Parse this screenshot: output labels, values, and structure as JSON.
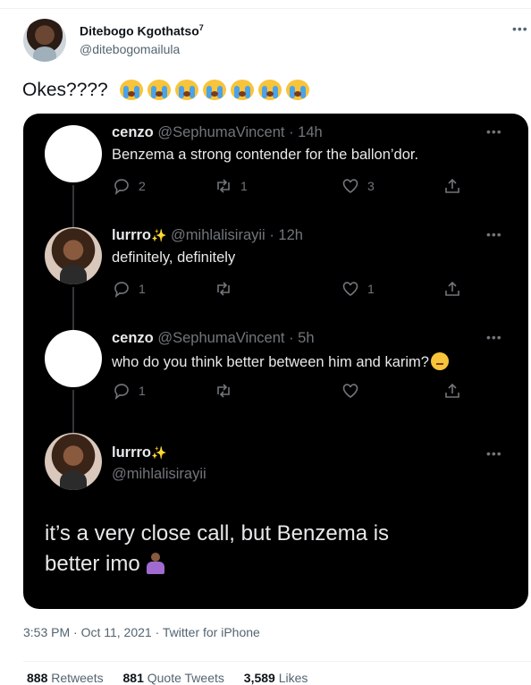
{
  "author": {
    "name": "Ditebogo Kgothatso",
    "name_suffix": "7",
    "handle": "@ditebogomailula"
  },
  "tweet": {
    "text": "Okes????",
    "emoji_icons": [
      "loudly-crying-face",
      "loudly-crying-face",
      "loudly-crying-face",
      "loudly-crying-face",
      "loudly-crying-face",
      "loudly-crying-face",
      "loudly-crying-face"
    ]
  },
  "screenshot_thread": [
    {
      "name": "cenzo",
      "handle": "@SephumaVincent",
      "time": "· 14h",
      "text": "Benzema a strong contender for the ballon’dor.",
      "replies": "2",
      "retweets": "1",
      "likes": "3"
    },
    {
      "name": "lurrro",
      "handle": "@mihlalisirayii",
      "time": "· 12h",
      "text": "definitely, definitely",
      "replies": "1",
      "retweets": "",
      "likes": "1"
    },
    {
      "name": "cenzo",
      "handle": "@SephumaVincent",
      "time": "· 5h",
      "text": "who do you think better between him and karim?",
      "replies": "1",
      "retweets": "",
      "likes": ""
    }
  ],
  "screenshot_main": {
    "name": "lurrro",
    "handle": "@mihlalisirayii",
    "text_line1": "it’s a very close call, but Benzema is",
    "text_line2": "better imo"
  },
  "meta": {
    "timestamp": "3:53 PM · Oct 11, 2021 · Twitter for iPhone"
  },
  "stats": {
    "retweets_count": "888",
    "retweets_label": "Retweets",
    "quotes_count": "881",
    "quotes_label": "Quote Tweets",
    "likes_count": "3,589",
    "likes_label": "Likes"
  },
  "colors": {
    "card_background": "#000000",
    "secondary_text": "#536471"
  }
}
